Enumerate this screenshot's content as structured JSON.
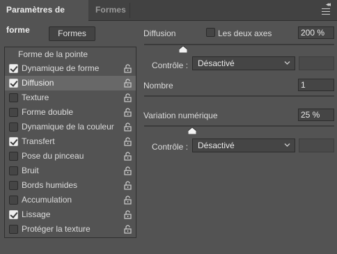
{
  "tabs": {
    "active": "Paramètres de forme",
    "inactive": "Formes"
  },
  "header_icons": {
    "collapse": "collapse-icon",
    "menu": "hamburger-menu-icon"
  },
  "formes_button": "Formes",
  "list": {
    "header": "Forme de la pointe",
    "items": [
      {
        "label": "Dynamique de forme",
        "checked": true,
        "selected": false
      },
      {
        "label": "Diffusion",
        "checked": true,
        "selected": true
      },
      {
        "label": "Texture",
        "checked": false,
        "selected": false
      },
      {
        "label": "Forme double",
        "checked": false,
        "selected": false
      },
      {
        "label": "Dynamique de la couleur",
        "checked": false,
        "selected": false
      },
      {
        "label": "Transfert",
        "checked": true,
        "selected": false
      },
      {
        "label": "Pose du pinceau",
        "checked": false,
        "selected": false
      },
      {
        "label": "Bruit",
        "checked": false,
        "selected": false
      },
      {
        "label": "Bords humides",
        "checked": false,
        "selected": false
      },
      {
        "label": "Accumulation",
        "checked": false,
        "selected": false
      },
      {
        "label": "Lissage",
        "checked": true,
        "selected": false
      },
      {
        "label": "Protéger la texture",
        "checked": false,
        "selected": false
      }
    ]
  },
  "settings": {
    "diffusion": {
      "label": "Diffusion",
      "both_axes_label": "Les deux axes",
      "both_axes_checked": false,
      "value": "200 %",
      "slider_fraction": 0.2
    },
    "control1": {
      "label": "Contrôle :",
      "value": "Désactivé"
    },
    "count": {
      "label": "Nombre",
      "value": "1",
      "slider_fraction": 0.0
    },
    "count_variation": {
      "label": "Variation numérique",
      "value": "25 %",
      "slider_fraction": 0.25
    },
    "control2": {
      "label": "Contrôle :",
      "value": "Désactivé"
    }
  },
  "colors": {
    "panel_bg": "#535353",
    "tabbar_bg": "#424242",
    "selected_row": "#686868",
    "field_bg": "#454545"
  }
}
